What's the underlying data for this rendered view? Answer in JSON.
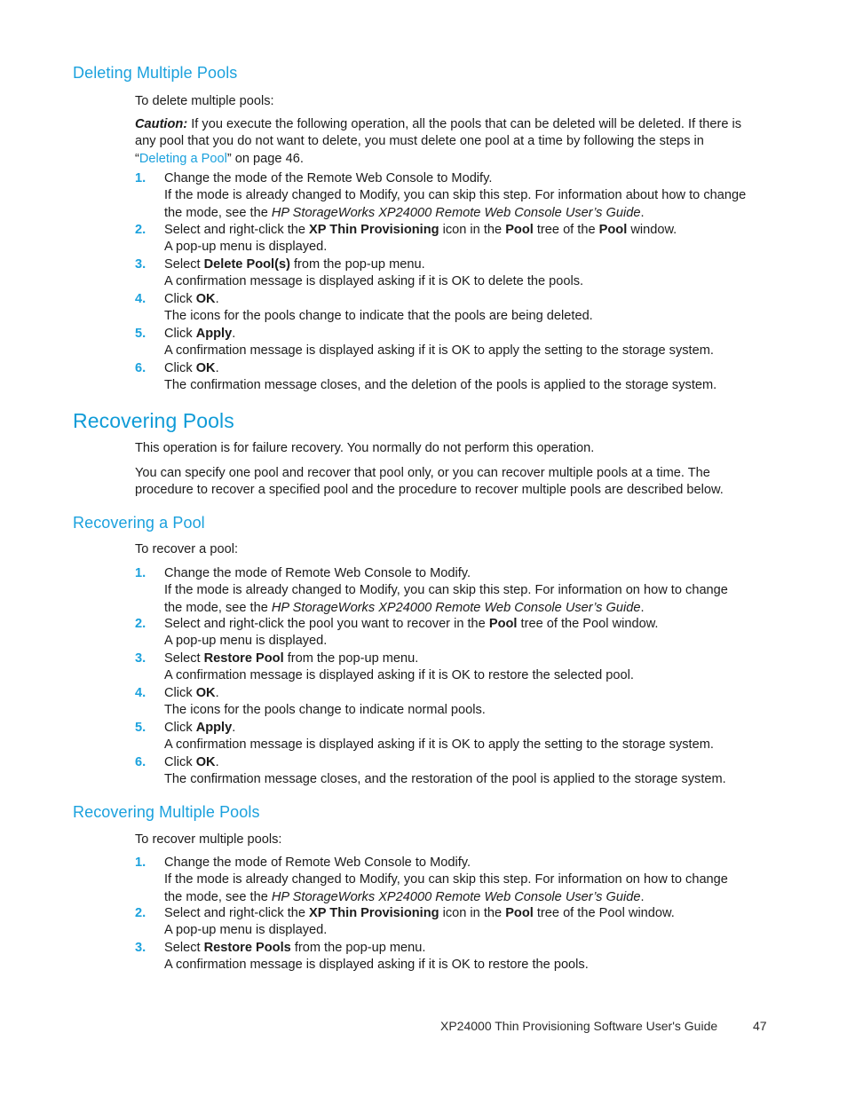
{
  "sections": [
    {
      "heading": "Deleting Multiple Pools",
      "heading_level": "h2",
      "intro": "To delete multiple pools:",
      "caution_label": "Caution:",
      "caution_text_1": " If you execute the following operation, all the pools that can be deleted will be deleted.  If there is any pool that you do not want to delete, you must delete one pool at a time by following the steps in “",
      "caution_link": "Deleting a Pool",
      "caution_text_2": "” on page 46.",
      "steps": [
        {
          "num": "1.",
          "line1_a": "Change the mode of the Remote Web Console to Modify.",
          "line2_a": "If the mode is already changed to Modify, you can skip this step.  For information about how to change the mode, see the ",
          "line2_i": "HP StorageWorks XP24000 Remote Web Console User’s Guide",
          "line2_b": "."
        },
        {
          "num": "2.",
          "line1_a": "Select and right-click the ",
          "line1_b1": "XP Thin Provisioning",
          "line1_c": " icon in the ",
          "line1_b2": "Pool",
          "line1_d": " tree of the ",
          "line1_b3": "Pool",
          "line1_e": " window.",
          "line2_a": "A pop-up menu is displayed."
        },
        {
          "num": "3.",
          "line1_a": "Select ",
          "line1_b1": "Delete Pool(s)",
          "line1_c": " from the pop-up menu.",
          "line2_a": "A confirmation message is displayed asking if it is OK to delete the pools."
        },
        {
          "num": "4.",
          "line1_a": "Click ",
          "line1_b1": "OK",
          "line1_c": ".",
          "line2_a": "The icons for the pools change to indicate that the pools are being deleted."
        },
        {
          "num": "5.",
          "line1_a": "Click ",
          "line1_b1": "Apply",
          "line1_c": ".",
          "line2_a": "A confirmation message is displayed asking if it is OK to apply the setting to the storage system."
        },
        {
          "num": "6.",
          "line1_a": "Click ",
          "line1_b1": "OK",
          "line1_c": ".",
          "line2_a": "The confirmation message closes, and the deletion of the pools is applied to the storage system."
        }
      ]
    },
    {
      "heading": "Recovering Pools",
      "heading_level": "h1",
      "para1": "This operation is for failure recovery.  You normally do not perform this operation.",
      "para2": "You can specify one pool and recover that pool only, or you can recover multiple pools at a time.  The procedure to recover a specified pool and the procedure to recover multiple pools are described below."
    },
    {
      "heading": "Recovering a Pool",
      "heading_level": "h2",
      "intro": "To recover a pool:",
      "steps": [
        {
          "num": "1.",
          "line1_a": "Change the mode of Remote Web Console to Modify.",
          "line2_a": "If the mode is already changed to Modify, you can skip this step.  For information on how to change the mode, see the ",
          "line2_i": "HP StorageWorks XP24000 Remote Web Console User’s Guide",
          "line2_b": "."
        },
        {
          "num": "2.",
          "line1_a": "Select and right-click the pool you want to recover in the ",
          "line1_b1": "Pool",
          "line1_c": " tree of the Pool window.",
          "line2_a": "A pop-up menu is displayed."
        },
        {
          "num": "3.",
          "line1_a": "Select ",
          "line1_b1": "Restore Pool",
          "line1_c": " from the pop-up menu.",
          "line2_a": "A confirmation message is displayed asking if it is OK to restore the selected pool."
        },
        {
          "num": "4.",
          "line1_a": "Click ",
          "line1_b1": "OK",
          "line1_c": ".",
          "line2_a": "The icons for the pools change to indicate normal pools."
        },
        {
          "num": "5.",
          "line1_a": "Click ",
          "line1_b1": "Apply",
          "line1_c": ".",
          "line2_a": "A confirmation message is displayed asking if it is OK to apply the setting to the storage system."
        },
        {
          "num": "6.",
          "line1_a": "Click ",
          "line1_b1": "OK",
          "line1_c": ".",
          "line2_a": "The confirmation message closes, and the restoration of the pool is applied to the storage system."
        }
      ]
    },
    {
      "heading": "Recovering Multiple Pools",
      "heading_level": "h2",
      "intro": "To recover multiple pools:",
      "steps": [
        {
          "num": "1.",
          "line1_a": "Change the mode of Remote Web Console to Modify.",
          "line2_a": "If the mode is already changed to Modify, you can skip this step.  For information on how to change the mode, see the ",
          "line2_i": "HP StorageWorks XP24000 Remote Web Console User’s Guide",
          "line2_b": "."
        },
        {
          "num": "2.",
          "line1_a": "Select and right-click the ",
          "line1_b1": "XP Thin Provisioning",
          "line1_c": " icon in the ",
          "line1_b2": "Pool",
          "line1_d": " tree of the Pool window.",
          "line2_a": "A pop-up menu is displayed."
        },
        {
          "num": "3.",
          "line1_a": "Select ",
          "line1_b1": "Restore Pools",
          "line1_c": " from the pop-up menu.",
          "line2_a": "A confirmation message is displayed asking if it is OK to restore the pools."
        }
      ]
    }
  ],
  "footer": {
    "title": "XP24000 Thin Provisioning Software User's Guide",
    "page_number": "47"
  },
  "colors": {
    "heading_blue": "#0f9bd7",
    "subheading_blue": "#1ba1dd",
    "link_blue": "#1ba1dd",
    "body_text": "#1b1b1b"
  }
}
